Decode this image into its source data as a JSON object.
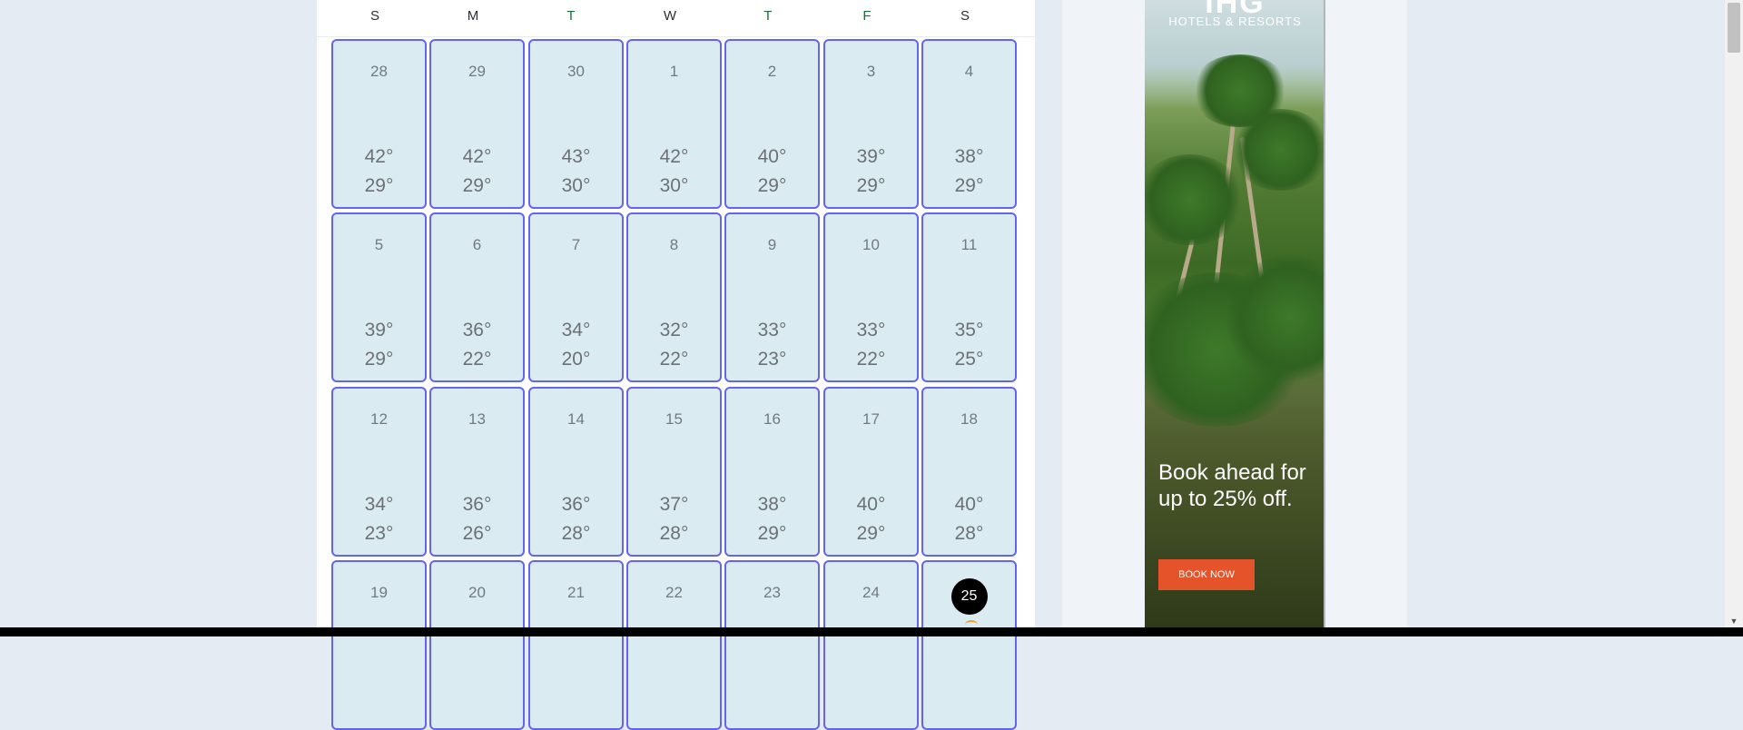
{
  "calendar": {
    "weekdays": [
      "S",
      "M",
      "T",
      "W",
      "T",
      "F",
      "S"
    ],
    "weeks": [
      [
        {
          "day": "28",
          "hi": "42°",
          "lo": "29°"
        },
        {
          "day": "29",
          "hi": "42°",
          "lo": "29°"
        },
        {
          "day": "30",
          "hi": "43°",
          "lo": "30°"
        },
        {
          "day": "1",
          "hi": "42°",
          "lo": "30°"
        },
        {
          "day": "2",
          "hi": "40°",
          "lo": "29°"
        },
        {
          "day": "3",
          "hi": "39°",
          "lo": "29°"
        },
        {
          "day": "4",
          "hi": "38°",
          "lo": "29°"
        }
      ],
      [
        {
          "day": "5",
          "hi": "39°",
          "lo": "29°"
        },
        {
          "day": "6",
          "hi": "36°",
          "lo": "22°"
        },
        {
          "day": "7",
          "hi": "34°",
          "lo": "20°"
        },
        {
          "day": "8",
          "hi": "32°",
          "lo": "22°"
        },
        {
          "day": "9",
          "hi": "33°",
          "lo": "23°"
        },
        {
          "day": "10",
          "hi": "33°",
          "lo": "22°"
        },
        {
          "day": "11",
          "hi": "35°",
          "lo": "25°"
        }
      ],
      [
        {
          "day": "12",
          "hi": "34°",
          "lo": "23°"
        },
        {
          "day": "13",
          "hi": "36°",
          "lo": "26°"
        },
        {
          "day": "14",
          "hi": "36°",
          "lo": "28°"
        },
        {
          "day": "15",
          "hi": "37°",
          "lo": "28°"
        },
        {
          "day": "16",
          "hi": "38°",
          "lo": "29°"
        },
        {
          "day": "17",
          "hi": "40°",
          "lo": "29°"
        },
        {
          "day": "18",
          "hi": "40°",
          "lo": "28°"
        }
      ],
      [
        {
          "day": "19"
        },
        {
          "day": "20"
        },
        {
          "day": "21"
        },
        {
          "day": "22"
        },
        {
          "day": "23"
        },
        {
          "day": "24"
        },
        {
          "day": "25",
          "today": true
        }
      ]
    ]
  },
  "ad": {
    "logo": "IHG",
    "brand": "HOTELS & RESORTS",
    "headline": "Book ahead for up to 25% off.",
    "cta": "BOOK NOW"
  },
  "colors": {
    "cell_bg": "#dbebf2",
    "cell_border": "#6464f0",
    "today_badge": "#000000",
    "cta": "#e5532b"
  }
}
